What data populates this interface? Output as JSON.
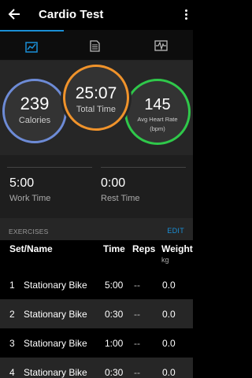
{
  "appbar": {
    "title": "Cardio Test"
  },
  "tabs": [
    {
      "name": "stats",
      "icon": "chart-tab-icon",
      "active": true
    },
    {
      "name": "details",
      "icon": "document-tab-icon",
      "active": false
    },
    {
      "name": "heartrate",
      "icon": "waveform-tab-icon",
      "active": false
    }
  ],
  "stats": {
    "calories": {
      "value": "239",
      "label": "Calories",
      "color": "#6d8bd6"
    },
    "total_time": {
      "value": "25:07",
      "label": "Total Time",
      "color": "#f0932b"
    },
    "heart_rate": {
      "value": "145",
      "label": "Avg Heart Rate",
      "unit": "(bpm)",
      "color": "#2fc84a"
    }
  },
  "times": {
    "work": {
      "value": "5:00",
      "label": "Work Time"
    },
    "rest": {
      "value": "0:00",
      "label": "Rest Time"
    }
  },
  "exercises": {
    "header_label": "EXERCISES",
    "edit_label": "EDIT",
    "columns": {
      "set_name": "Set/Name",
      "time": "Time",
      "reps": "Reps",
      "weight": "Weight",
      "weight_unit": "kg"
    },
    "rows": [
      {
        "num": "1",
        "name": "Stationary Bike",
        "time": "5:00",
        "reps": "--",
        "weight": "0.0"
      },
      {
        "num": "2",
        "name": "Stationary Bike",
        "time": "0:30",
        "reps": "--",
        "weight": "0.0"
      },
      {
        "num": "3",
        "name": "Stationary Bike",
        "time": "1:00",
        "reps": "--",
        "weight": "0.0"
      },
      {
        "num": "4",
        "name": "Stationary Bike",
        "time": "0:30",
        "reps": "--",
        "weight": "0.0"
      }
    ]
  },
  "colors": {
    "accent": "#1a8fd6"
  }
}
